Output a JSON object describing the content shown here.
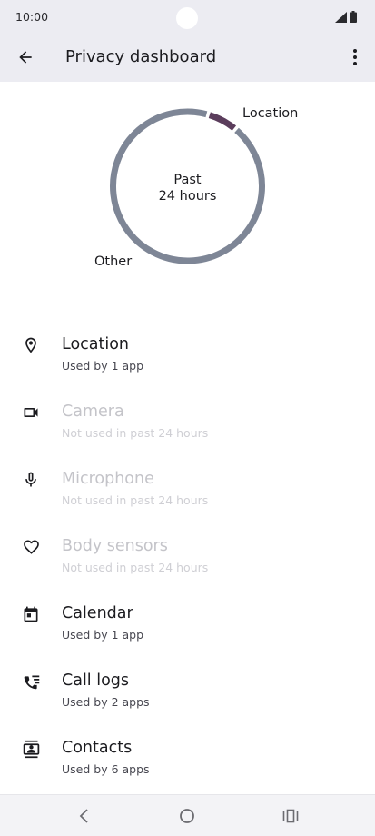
{
  "status": {
    "time": "10:00"
  },
  "header": {
    "title": "Privacy dashboard"
  },
  "chart_data": {
    "type": "pie",
    "center_label": [
      "Past",
      "24 hours"
    ],
    "slices": [
      {
        "name": "Location",
        "value": 1,
        "color": "#5b3d5c"
      },
      {
        "name": "Other",
        "value": 14,
        "color": "#7e8696"
      }
    ]
  },
  "items": [
    {
      "label": "Location",
      "subtitle": "Used by 1 app",
      "icon": "location-pin-icon",
      "enabled": true
    },
    {
      "label": "Camera",
      "subtitle": "Not used in past 24 hours",
      "icon": "videocam-icon",
      "enabled": false
    },
    {
      "label": "Microphone",
      "subtitle": "Not used in past 24 hours",
      "icon": "microphone-icon",
      "enabled": false
    },
    {
      "label": "Body sensors",
      "subtitle": "Not used in past 24 hours",
      "icon": "heart-icon",
      "enabled": false
    },
    {
      "label": "Calendar",
      "subtitle": "Used by 1 app",
      "icon": "calendar-icon",
      "enabled": true
    },
    {
      "label": "Call logs",
      "subtitle": "Used by 2 apps",
      "icon": "call-log-icon",
      "enabled": true
    },
    {
      "label": "Contacts",
      "subtitle": "Used by 6 apps",
      "icon": "contacts-icon",
      "enabled": true
    }
  ],
  "colors": {
    "header_bg": "#ececf2",
    "disabled_text": "#c4c4c9"
  }
}
